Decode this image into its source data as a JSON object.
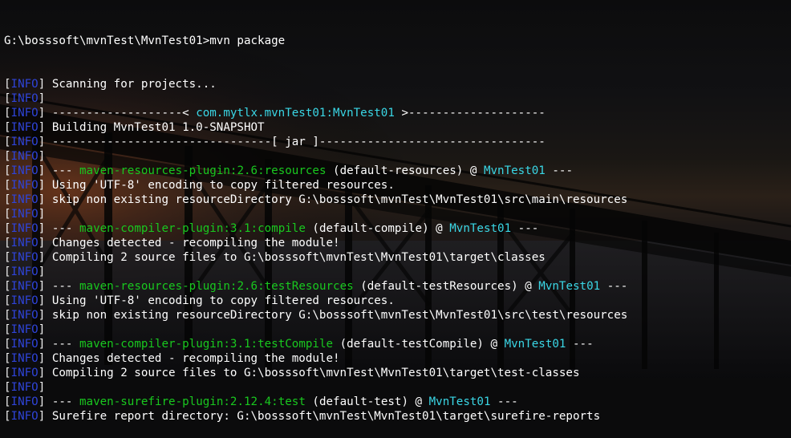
{
  "colors": {
    "background": "#0b0b0c",
    "text": "#ffffff",
    "info_tag": "#2f44d9",
    "plugin_green": "#19c81f",
    "artifact_cyan": "#3ad7e6"
  },
  "wallpaper": {
    "icon": "pier-sunset-wallpaper"
  },
  "prompt": {
    "path": "G:\\bosssoft\\mvnTest\\MvnTest01>",
    "command": "mvn package"
  },
  "lines": [
    [
      {
        "t": "[",
        "c": "tag-bracket"
      },
      {
        "t": "INFO",
        "c": "tag-info"
      },
      {
        "t": "] ",
        "c": "tag-bracket"
      },
      {
        "t": "Scanning for projects...",
        "c": "white"
      }
    ],
    [
      {
        "t": "[",
        "c": "tag-bracket"
      },
      {
        "t": "INFO",
        "c": "tag-info"
      },
      {
        "t": "]",
        "c": "tag-bracket"
      }
    ],
    [
      {
        "t": "[",
        "c": "tag-bracket"
      },
      {
        "t": "INFO",
        "c": "tag-info"
      },
      {
        "t": "] ",
        "c": "tag-bracket"
      },
      {
        "t": "-------------------< ",
        "c": "white"
      },
      {
        "t": "com.mytlx.mvnTest01:MvnTest01",
        "c": "cyan"
      },
      {
        "t": " >--------------------",
        "c": "white"
      }
    ],
    [
      {
        "t": "[",
        "c": "tag-bracket"
      },
      {
        "t": "INFO",
        "c": "tag-info"
      },
      {
        "t": "] ",
        "c": "tag-bracket"
      },
      {
        "t": "Building MvnTest01 1.0-SNAPSHOT",
        "c": "white"
      }
    ],
    [
      {
        "t": "[",
        "c": "tag-bracket"
      },
      {
        "t": "INFO",
        "c": "tag-info"
      },
      {
        "t": "] ",
        "c": "tag-bracket"
      },
      {
        "t": "--------------------------------[ jar ]---------------------------------",
        "c": "white"
      }
    ],
    [
      {
        "t": "[",
        "c": "tag-bracket"
      },
      {
        "t": "INFO",
        "c": "tag-info"
      },
      {
        "t": "]",
        "c": "tag-bracket"
      }
    ],
    [
      {
        "t": "[",
        "c": "tag-bracket"
      },
      {
        "t": "INFO",
        "c": "tag-info"
      },
      {
        "t": "] ",
        "c": "tag-bracket"
      },
      {
        "t": "--- ",
        "c": "white"
      },
      {
        "t": "maven-resources-plugin:2.6:resources",
        "c": "green"
      },
      {
        "t": " (default-resources) @ ",
        "c": "white"
      },
      {
        "t": "MvnTest01",
        "c": "cyan"
      },
      {
        "t": " ---",
        "c": "white"
      }
    ],
    [
      {
        "t": "[",
        "c": "tag-bracket"
      },
      {
        "t": "INFO",
        "c": "tag-info"
      },
      {
        "t": "] ",
        "c": "tag-bracket"
      },
      {
        "t": "Using 'UTF-8' encoding to copy filtered resources.",
        "c": "white"
      }
    ],
    [
      {
        "t": "[",
        "c": "tag-bracket"
      },
      {
        "t": "INFO",
        "c": "tag-info"
      },
      {
        "t": "] ",
        "c": "tag-bracket"
      },
      {
        "t": "skip non existing resourceDirectory G:\\bosssoft\\mvnTest\\MvnTest01\\src\\main\\resources",
        "c": "white"
      }
    ],
    [
      {
        "t": "[",
        "c": "tag-bracket"
      },
      {
        "t": "INFO",
        "c": "tag-info"
      },
      {
        "t": "]",
        "c": "tag-bracket"
      }
    ],
    [
      {
        "t": "[",
        "c": "tag-bracket"
      },
      {
        "t": "INFO",
        "c": "tag-info"
      },
      {
        "t": "] ",
        "c": "tag-bracket"
      },
      {
        "t": "--- ",
        "c": "white"
      },
      {
        "t": "maven-compiler-plugin:3.1:compile",
        "c": "green"
      },
      {
        "t": " (default-compile) @ ",
        "c": "white"
      },
      {
        "t": "MvnTest01",
        "c": "cyan"
      },
      {
        "t": " ---",
        "c": "white"
      }
    ],
    [
      {
        "t": "[",
        "c": "tag-bracket"
      },
      {
        "t": "INFO",
        "c": "tag-info"
      },
      {
        "t": "] ",
        "c": "tag-bracket"
      },
      {
        "t": "Changes detected - recompiling the module!",
        "c": "white"
      }
    ],
    [
      {
        "t": "[",
        "c": "tag-bracket"
      },
      {
        "t": "INFO",
        "c": "tag-info"
      },
      {
        "t": "] ",
        "c": "tag-bracket"
      },
      {
        "t": "Compiling 2 source files to G:\\bosssoft\\mvnTest\\MvnTest01\\target\\classes",
        "c": "white"
      }
    ],
    [
      {
        "t": "[",
        "c": "tag-bracket"
      },
      {
        "t": "INFO",
        "c": "tag-info"
      },
      {
        "t": "]",
        "c": "tag-bracket"
      }
    ],
    [
      {
        "t": "[",
        "c": "tag-bracket"
      },
      {
        "t": "INFO",
        "c": "tag-info"
      },
      {
        "t": "] ",
        "c": "tag-bracket"
      },
      {
        "t": "--- ",
        "c": "white"
      },
      {
        "t": "maven-resources-plugin:2.6:testResources",
        "c": "green"
      },
      {
        "t": " (default-testResources) @ ",
        "c": "white"
      },
      {
        "t": "MvnTest01",
        "c": "cyan"
      },
      {
        "t": " ---",
        "c": "white"
      }
    ],
    [
      {
        "t": "[",
        "c": "tag-bracket"
      },
      {
        "t": "INFO",
        "c": "tag-info"
      },
      {
        "t": "] ",
        "c": "tag-bracket"
      },
      {
        "t": "Using 'UTF-8' encoding to copy filtered resources.",
        "c": "white"
      }
    ],
    [
      {
        "t": "[",
        "c": "tag-bracket"
      },
      {
        "t": "INFO",
        "c": "tag-info"
      },
      {
        "t": "] ",
        "c": "tag-bracket"
      },
      {
        "t": "skip non existing resourceDirectory G:\\bosssoft\\mvnTest\\MvnTest01\\src\\test\\resources",
        "c": "white"
      }
    ],
    [
      {
        "t": "[",
        "c": "tag-bracket"
      },
      {
        "t": "INFO",
        "c": "tag-info"
      },
      {
        "t": "]",
        "c": "tag-bracket"
      }
    ],
    [
      {
        "t": "[",
        "c": "tag-bracket"
      },
      {
        "t": "INFO",
        "c": "tag-info"
      },
      {
        "t": "] ",
        "c": "tag-bracket"
      },
      {
        "t": "--- ",
        "c": "white"
      },
      {
        "t": "maven-compiler-plugin:3.1:testCompile",
        "c": "green"
      },
      {
        "t": " (default-testCompile) @ ",
        "c": "white"
      },
      {
        "t": "MvnTest01",
        "c": "cyan"
      },
      {
        "t": " ---",
        "c": "white"
      }
    ],
    [
      {
        "t": "[",
        "c": "tag-bracket"
      },
      {
        "t": "INFO",
        "c": "tag-info"
      },
      {
        "t": "] ",
        "c": "tag-bracket"
      },
      {
        "t": "Changes detected - recompiling the module!",
        "c": "white"
      }
    ],
    [
      {
        "t": "[",
        "c": "tag-bracket"
      },
      {
        "t": "INFO",
        "c": "tag-info"
      },
      {
        "t": "] ",
        "c": "tag-bracket"
      },
      {
        "t": "Compiling 2 source files to G:\\bosssoft\\mvnTest\\MvnTest01\\target\\test-classes",
        "c": "white"
      }
    ],
    [
      {
        "t": "[",
        "c": "tag-bracket"
      },
      {
        "t": "INFO",
        "c": "tag-info"
      },
      {
        "t": "]",
        "c": "tag-bracket"
      }
    ],
    [
      {
        "t": "[",
        "c": "tag-bracket"
      },
      {
        "t": "INFO",
        "c": "tag-info"
      },
      {
        "t": "] ",
        "c": "tag-bracket"
      },
      {
        "t": "--- ",
        "c": "white"
      },
      {
        "t": "maven-surefire-plugin:2.12.4:test",
        "c": "green"
      },
      {
        "t": " (default-test) @ ",
        "c": "white"
      },
      {
        "t": "MvnTest01",
        "c": "cyan"
      },
      {
        "t": " ---",
        "c": "white"
      }
    ],
    [
      {
        "t": "[",
        "c": "tag-bracket"
      },
      {
        "t": "INFO",
        "c": "tag-info"
      },
      {
        "t": "] ",
        "c": "tag-bracket"
      },
      {
        "t": "Surefire report directory: G:\\bosssoft\\mvnTest\\MvnTest01\\target\\surefire-reports",
        "c": "white"
      }
    ]
  ]
}
